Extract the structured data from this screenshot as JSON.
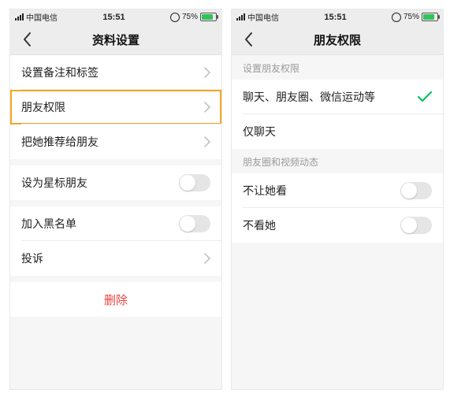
{
  "status": {
    "carrier": "中国电信",
    "time": "15:51",
    "battery_pct": "75%"
  },
  "left_screen": {
    "nav_title": "资料设置",
    "cells": {
      "remark_tag": "设置备注和标签",
      "friend_perm": "朋友权限",
      "recommend": "把她推荐给朋友",
      "star": "设为星标朋友",
      "blacklist": "加入黑名单",
      "complaint": "投诉",
      "delete": "删除"
    }
  },
  "right_screen": {
    "nav_title": "朋友权限",
    "section1_label": "设置朋友权限",
    "option_all": "聊天、朋友圈、微信运动等",
    "option_chatonly": "仅聊天",
    "section2_label": "朋友圈和视频动态",
    "hide_mine": "不让她看",
    "hide_hers": "不看她"
  }
}
